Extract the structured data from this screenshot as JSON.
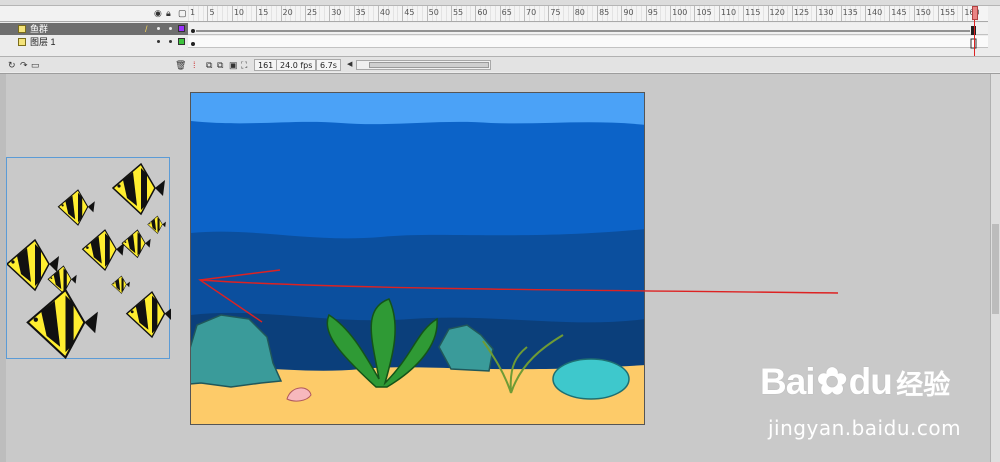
{
  "timeline": {
    "ruler_numbers": [
      "1",
      "5",
      "10",
      "15",
      "20",
      "25",
      "30",
      "35",
      "40",
      "45",
      "50",
      "55",
      "60",
      "65",
      "70",
      "75",
      "80",
      "85",
      "90",
      "95",
      "100",
      "105",
      "110",
      "115",
      "120",
      "125",
      "130",
      "135",
      "140",
      "145",
      "150",
      "155",
      "160"
    ],
    "layers": [
      {
        "name": "鱼群",
        "selected": true,
        "color": "#9b30ff"
      },
      {
        "name": "图层 1",
        "selected": false,
        "color": "#3ec43e"
      }
    ],
    "status": {
      "current_frame": "161",
      "fps": "24.0 fps",
      "time": "6.7s"
    }
  },
  "stage": {
    "sky_color": "#4ba2f7",
    "water_color": "#0c63c8",
    "deep_color": "#0b3f7b",
    "sand_color": "#fdcb69"
  },
  "watermark": {
    "logo": "Bai",
    "logo2": "du",
    "cn": "经验",
    "url": "jingyan.baidu.com"
  }
}
